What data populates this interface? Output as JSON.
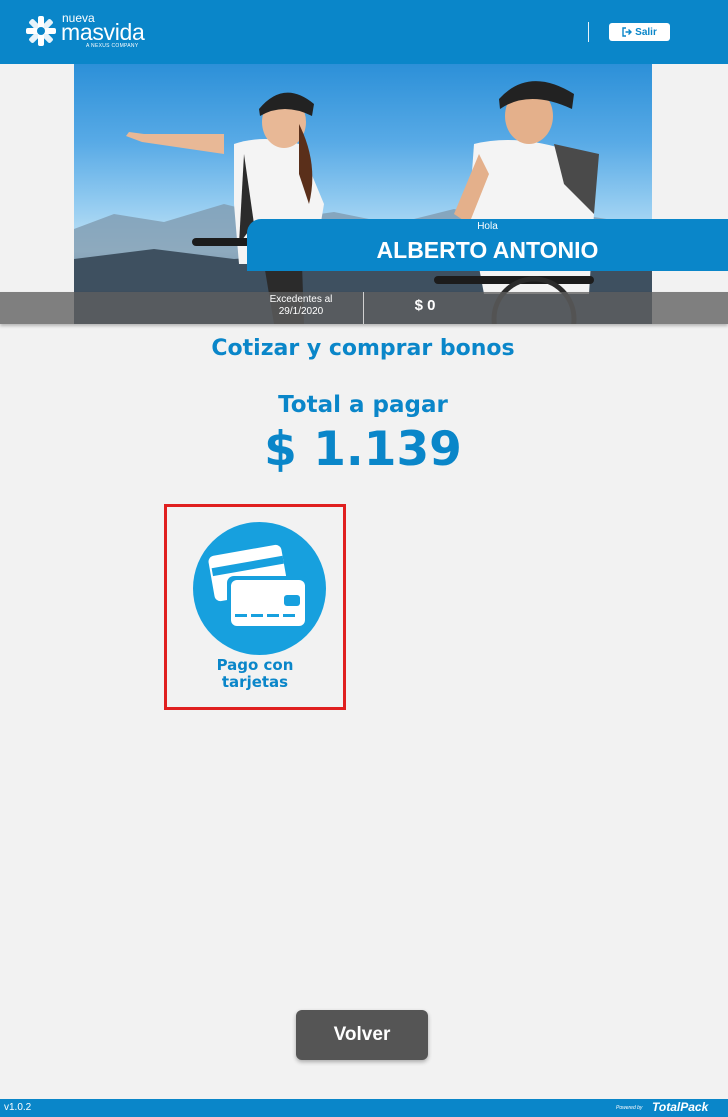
{
  "header": {
    "logo_nueva": "nueva",
    "logo_masvida": "masvida",
    "logo_tagline": "A NEXUS COMPANY",
    "logout_label": "Salir",
    "brand_color": "#0a86c9"
  },
  "hero": {
    "greeting": "Hola",
    "user_name": "ALBERTO ANTONIO",
    "excedentes_label": "Excedentes al 29/1/2020",
    "excedentes_value": "$ 0"
  },
  "main": {
    "section_title": "Cotizar y comprar bonos",
    "total_label": "Total a pagar",
    "total_amount": "$ 1.139",
    "payment_option_label": "Pago con tarjetas",
    "payment_option_icon": "credit-cards-icon",
    "highlight_color": "#e02020"
  },
  "actions": {
    "back_label": "Volver"
  },
  "footer": {
    "version": "v1.0.2",
    "powered_by": "Powered by",
    "brand": "TotalPack"
  }
}
